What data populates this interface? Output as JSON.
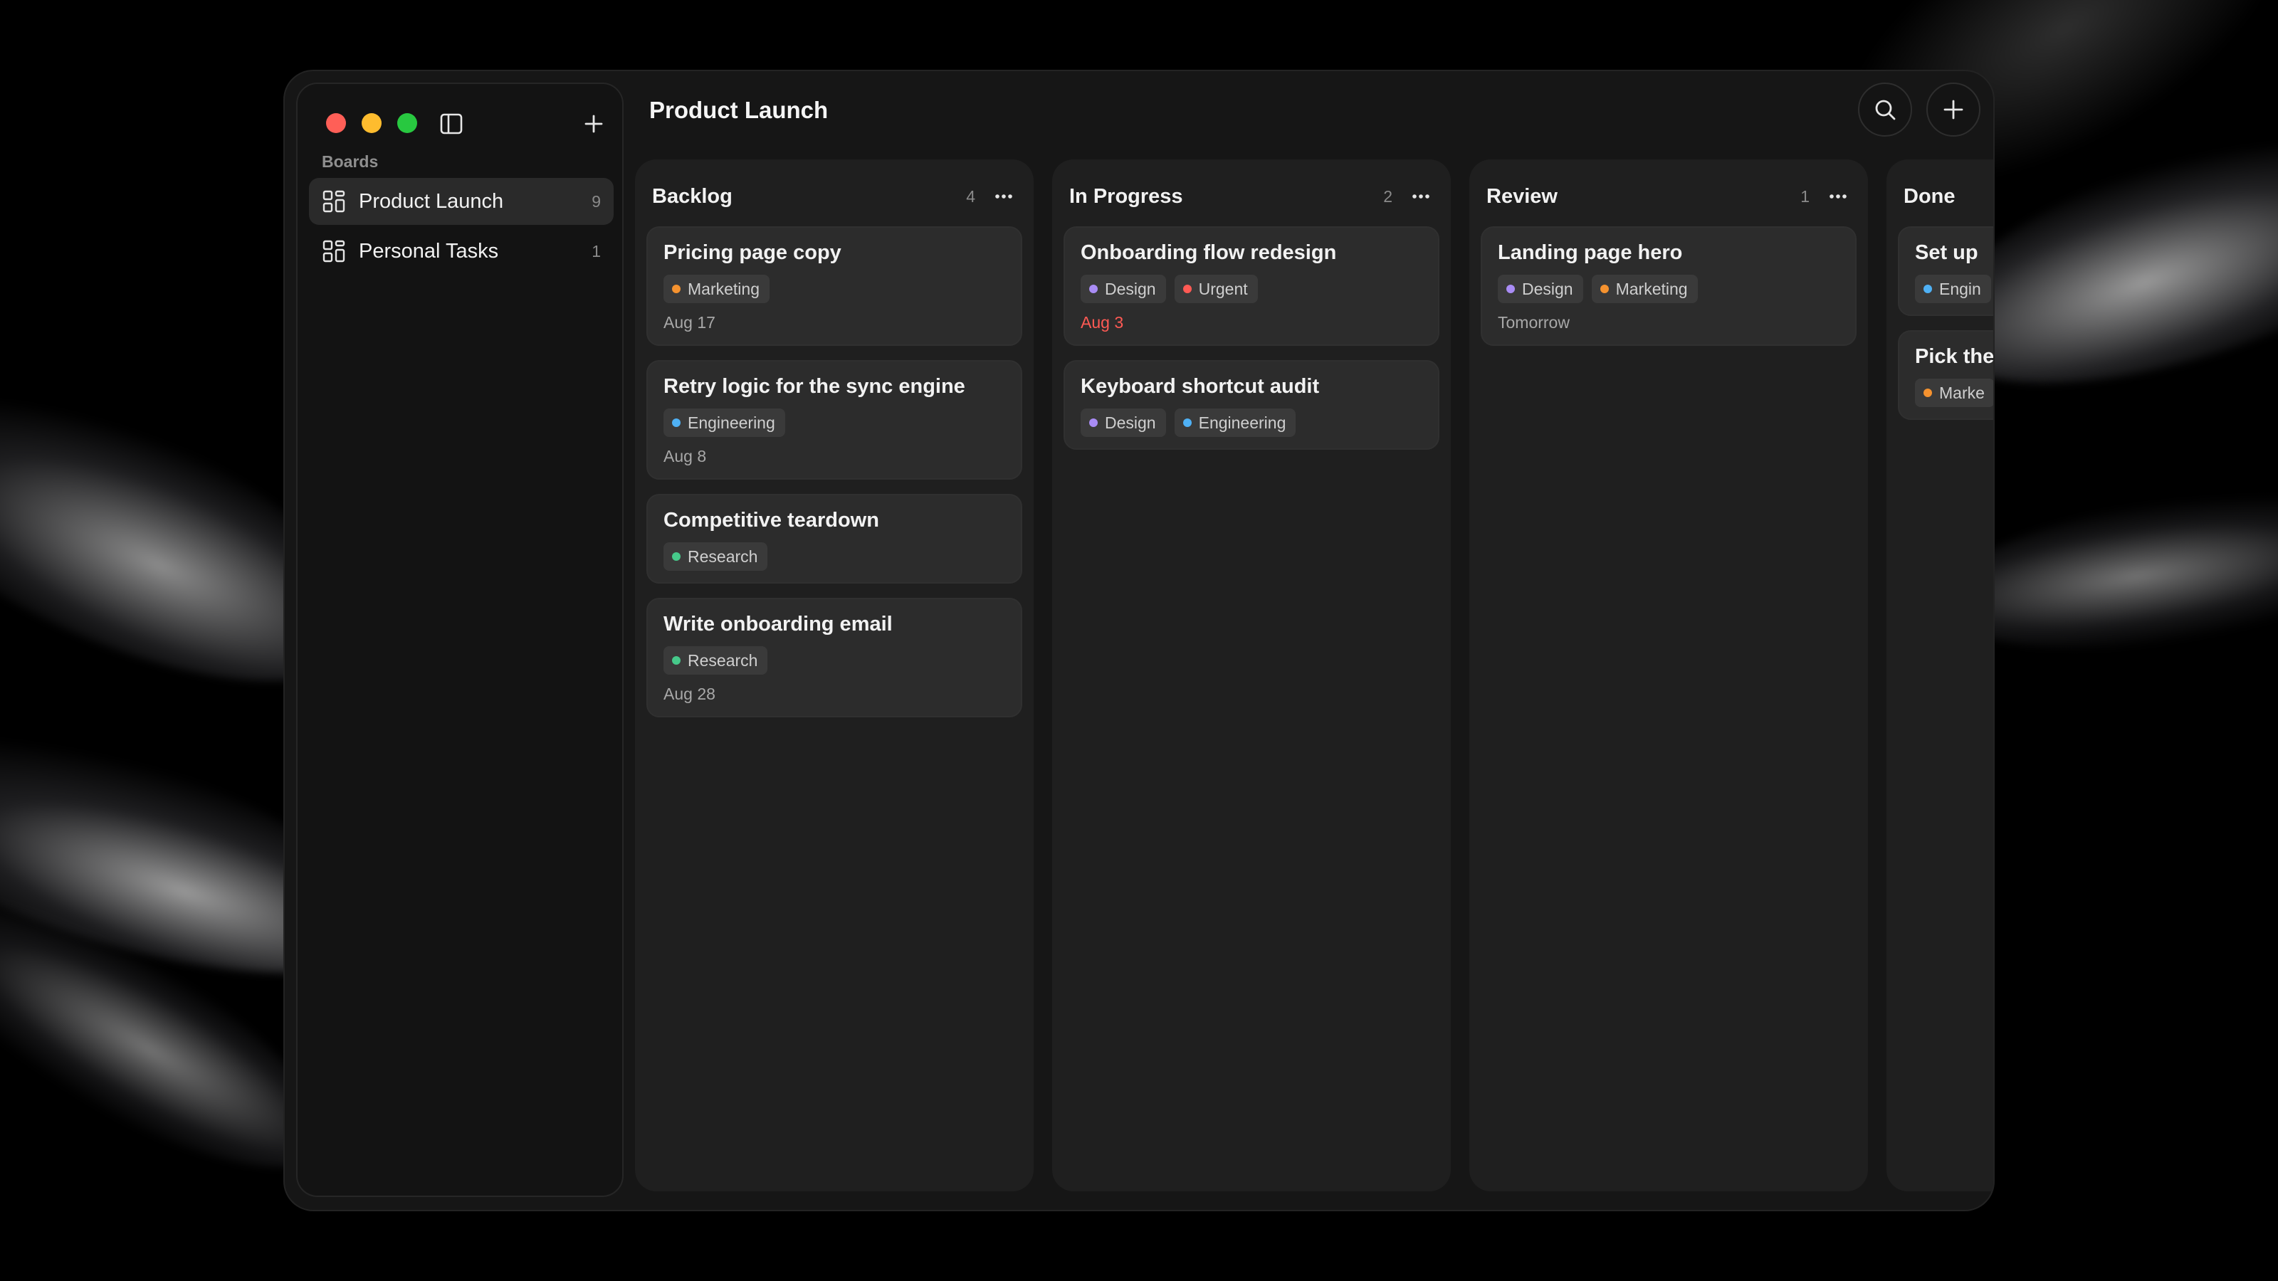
{
  "app": {
    "sidebar": {
      "section_label": "Boards",
      "boards": [
        {
          "name": "Product Launch",
          "count": "9",
          "active": true
        },
        {
          "name": "Personal Tasks",
          "count": "1",
          "active": false
        }
      ]
    },
    "header": {
      "title": "Product Launch"
    },
    "tag_colors": {
      "Marketing": "#f5922f",
      "Engineering": "#4fb1f5",
      "Research": "#46c98a",
      "Design": "#a98cf5",
      "Urgent": "#ff5a54"
    },
    "columns": [
      {
        "title": "Backlog",
        "count": "4",
        "cards": [
          {
            "title": "Pricing page copy",
            "tags": [
              "Marketing"
            ],
            "due": "Aug 17",
            "overdue": false
          },
          {
            "title": "Retry logic for the sync engine",
            "tags": [
              "Engineering"
            ],
            "due": "Aug 8",
            "overdue": false
          },
          {
            "title": "Competitive teardown",
            "tags": [
              "Research"
            ],
            "due": "",
            "overdue": false
          },
          {
            "title": "Write onboarding email",
            "tags": [
              "Research"
            ],
            "due": "Aug 28",
            "overdue": false
          }
        ]
      },
      {
        "title": "In Progress",
        "count": "2",
        "cards": [
          {
            "title": "Onboarding flow redesign",
            "tags": [
              "Design",
              "Urgent"
            ],
            "due": "Aug 3",
            "overdue": true
          },
          {
            "title": "Keyboard shortcut audit",
            "tags": [
              "Design",
              "Engineering"
            ],
            "due": "",
            "overdue": false
          }
        ]
      },
      {
        "title": "Review",
        "count": "1",
        "cards": [
          {
            "title": "Landing page hero",
            "tags": [
              "Design",
              "Marketing"
            ],
            "due": "Tomorrow",
            "overdue": false
          }
        ]
      },
      {
        "title": "Done",
        "count": "",
        "cards": [
          {
            "title": "Set up",
            "tags": [
              "Engin"
            ],
            "due": "",
            "overdue": false
          },
          {
            "title": "Pick the",
            "tags": [
              "Marke"
            ],
            "due": "",
            "overdue": false
          }
        ]
      }
    ],
    "done_tag_colors": [
      "#4fb1f5",
      "#f5922f"
    ]
  }
}
